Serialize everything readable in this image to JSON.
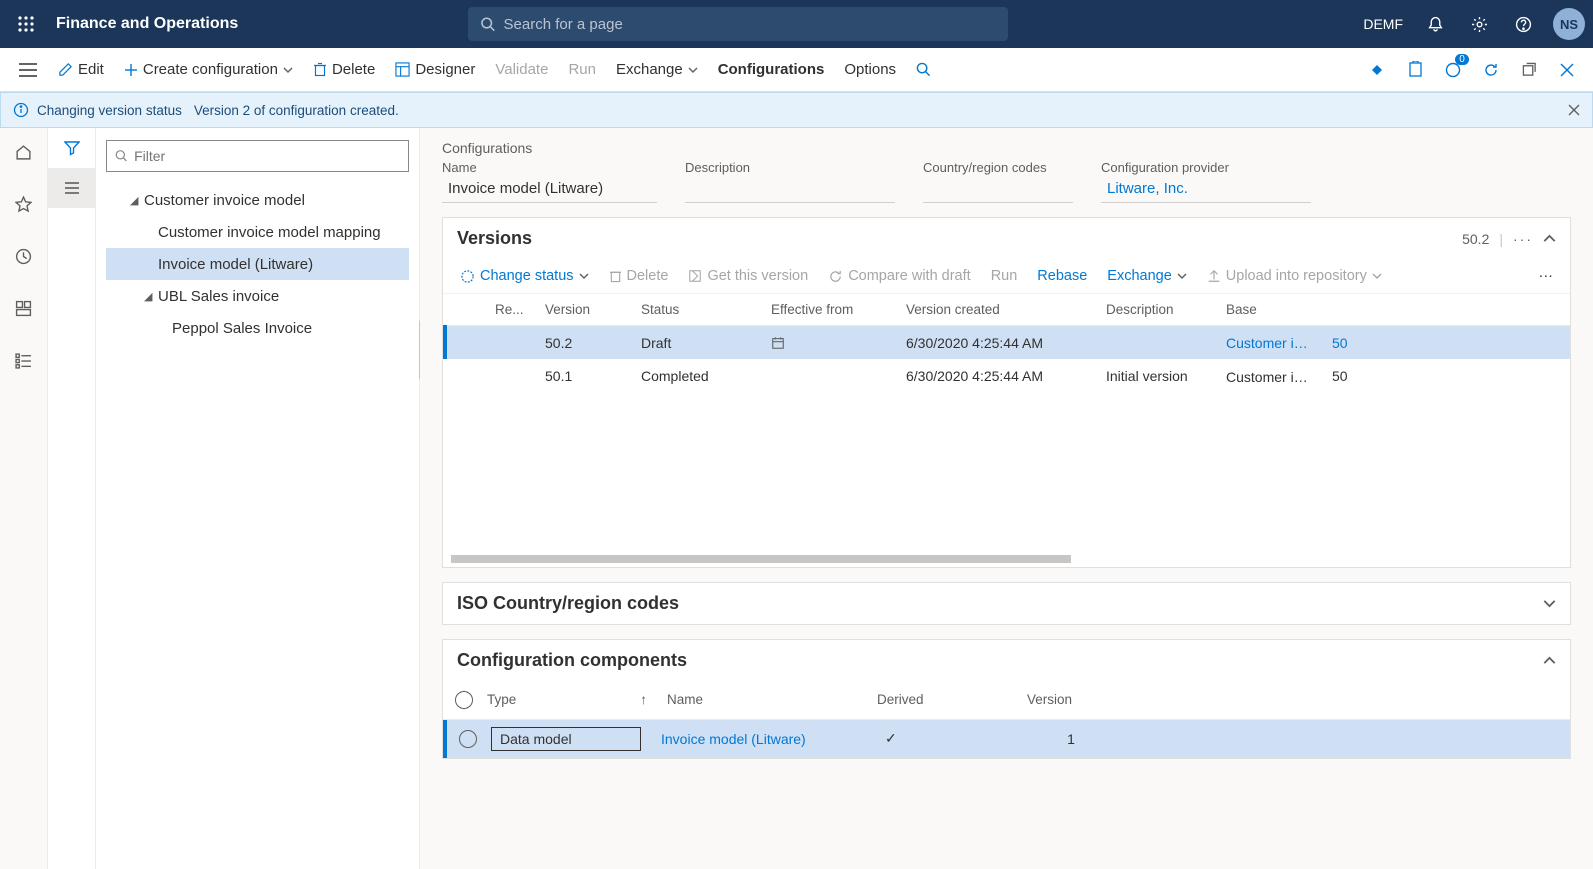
{
  "header": {
    "app_title": "Finance and Operations",
    "search_placeholder": "Search for a page",
    "company": "DEMF",
    "avatar": "NS",
    "notif_badge": "0"
  },
  "commands": {
    "edit": "Edit",
    "create": "Create configuration",
    "delete": "Delete",
    "designer": "Designer",
    "validate": "Validate",
    "run": "Run",
    "exchange": "Exchange",
    "configurations": "Configurations",
    "options": "Options"
  },
  "notification": {
    "title": "Changing version status",
    "msg": "Version 2 of configuration created."
  },
  "tree": {
    "filter_placeholder": "Filter",
    "n0": "Customer invoice model",
    "n1": "Customer invoice model mapping",
    "n2": "Invoice model (Litware)",
    "n3": "UBL Sales invoice",
    "n4": "Peppol Sales Invoice"
  },
  "config": {
    "section": "Configurations",
    "name_label": "Name",
    "name_val": "Invoice model (Litware)",
    "desc_label": "Description",
    "desc_val": "",
    "codes_label": "Country/region codes",
    "codes_val": "",
    "provider_label": "Configuration provider",
    "provider_val": "Litware, Inc."
  },
  "versions": {
    "title": "Versions",
    "current": "50.2",
    "more": "···",
    "tool": {
      "change": "Change status",
      "delete": "Delete",
      "get": "Get this version",
      "compare": "Compare with draft",
      "run": "Run",
      "rebase": "Rebase",
      "exchange": "Exchange",
      "upload": "Upload into repository"
    },
    "cols": {
      "re": "Re...",
      "ver": "Version",
      "status": "Status",
      "eff": "Effective from",
      "created": "Version created",
      "desc": "Description",
      "base": "Base",
      "basenum": ""
    },
    "rows": [
      {
        "re": "",
        "ver": "50.2",
        "status": "Draft",
        "eff_icon": true,
        "created": "6/30/2020 4:25:44 AM",
        "desc": "",
        "base": "Customer in…",
        "base_link": true,
        "basenum": "50"
      },
      {
        "re": "",
        "ver": "50.1",
        "status": "Completed",
        "eff_icon": false,
        "created": "6/30/2020 4:25:44 AM",
        "desc": "Initial version",
        "base": "Customer in…",
        "base_link": false,
        "basenum": "50"
      }
    ]
  },
  "iso": {
    "title": "ISO Country/region codes"
  },
  "components": {
    "title": "Configuration components",
    "cols": {
      "type": "Type",
      "name": "Name",
      "derived": "Derived",
      "version": "Version"
    },
    "row": {
      "type": "Data model",
      "name": "Invoice model (Litware)",
      "derived": "✓",
      "version": "1"
    }
  }
}
